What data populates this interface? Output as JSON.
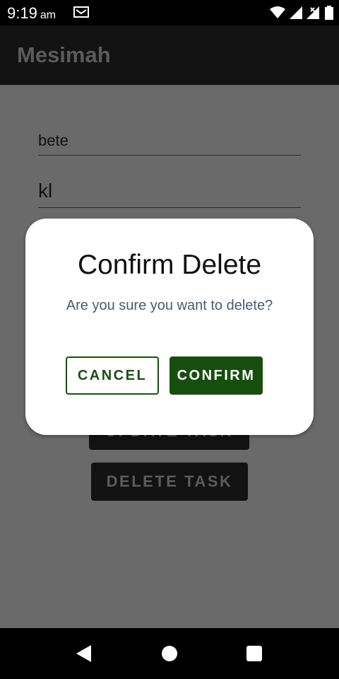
{
  "status_bar": {
    "time": "9:19",
    "ampm": "am",
    "icons": [
      "mail-icon",
      "wifi-icon",
      "signal-icon",
      "signal-x-icon",
      "battery-icon"
    ]
  },
  "app_bar": {
    "title": "Mesimah"
  },
  "form": {
    "field_1_value": "bete",
    "field_2_value": "kl",
    "update_button_label": "UPDATE TASK",
    "delete_button_label": "DELETE TASK"
  },
  "dialog": {
    "title": "Confirm Delete",
    "message": "Are you sure you want to delete?",
    "cancel_label": "CANCEL",
    "confirm_label": "CONFIRM"
  },
  "nav_bar": {
    "icons": [
      "back-icon",
      "home-icon",
      "recents-icon"
    ]
  },
  "colors": {
    "primary_green": "#184d10",
    "scrim": "#6a6a6a",
    "app_bar": "#121212"
  }
}
